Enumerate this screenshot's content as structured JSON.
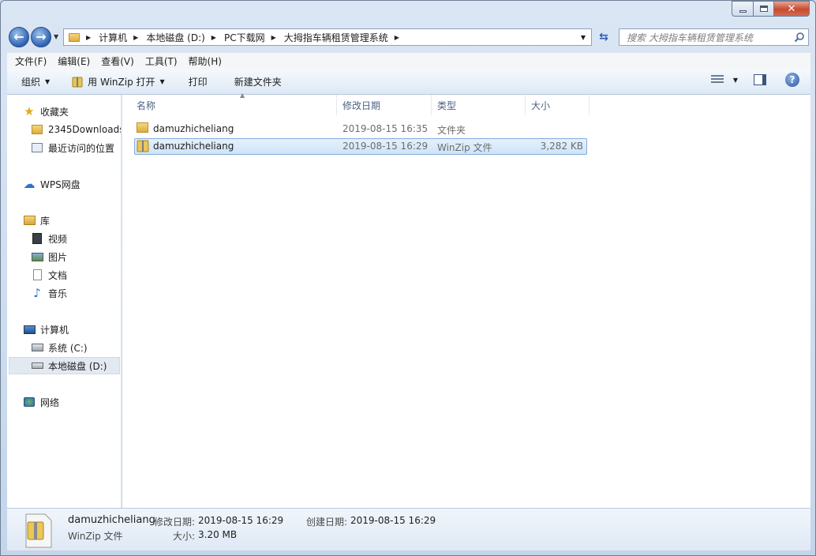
{
  "address": {
    "crumbs": [
      "计算机",
      "本地磁盘 (D:)",
      "PC下载网",
      "大拇指车辆租赁管理系统"
    ]
  },
  "search": {
    "placeholder": "搜索 大拇指车辆租赁管理系统"
  },
  "menu": [
    "文件(F)",
    "编辑(E)",
    "查看(V)",
    "工具(T)",
    "帮助(H)"
  ],
  "toolbar": {
    "organize": "组织",
    "open_winzip": "用 WinZip 打开",
    "print": "打印",
    "new_folder": "新建文件夹",
    "help": "?"
  },
  "nav": {
    "favorites": "收藏夹",
    "downloads": "2345Downloads",
    "recent": "最近访问的位置",
    "wps": "WPS网盘",
    "libraries": "库",
    "videos": "视频",
    "pictures": "图片",
    "documents": "文档",
    "music": "音乐",
    "computer": "计算机",
    "drive_c": "系统 (C:)",
    "drive_d": "本地磁盘 (D:)",
    "network": "网络"
  },
  "columns": {
    "name": "名称",
    "modified": "修改日期",
    "type": "类型",
    "size": "大小"
  },
  "files": [
    {
      "name": "damuzhicheliang",
      "modified": "2019-08-15 16:35",
      "type": "文件夹",
      "size": ""
    },
    {
      "name": "damuzhicheliang",
      "modified": "2019-08-15 16:29",
      "type": "WinZip 文件",
      "size": "3,282 KB"
    }
  ],
  "details": {
    "name": "damuzhicheliang",
    "modified_label": "修改日期:",
    "modified": "2019-08-15 16:29",
    "created_label": "创建日期:",
    "created": "2019-08-15 16:29",
    "type": "WinZip 文件",
    "size_label": "大小:",
    "size": "3.20 MB"
  },
  "colors": {
    "accent": "#2d62b4",
    "selection": "#cfe4f8",
    "header_text": "#4d6185"
  }
}
